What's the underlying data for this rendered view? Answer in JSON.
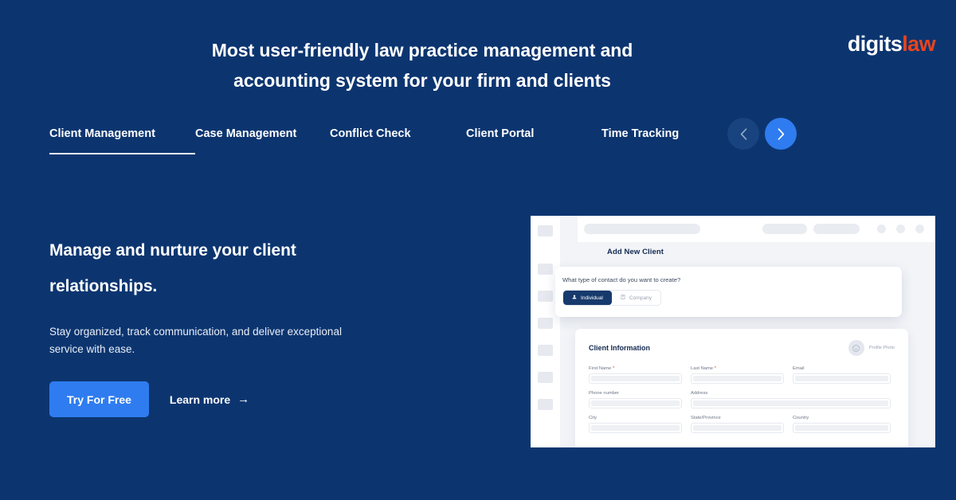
{
  "brand": {
    "logo_first": "digits",
    "logo_second": "law",
    "accent_orange": "#e8441f",
    "accent_blue": "#2f7cf0",
    "background_navy": "#0c3570"
  },
  "headline": {
    "line1": "Most user-friendly law practice management and",
    "line2": "accounting system for your firm and clients"
  },
  "tabs": [
    {
      "label": "Client Management",
      "active": true
    },
    {
      "label": "Case Management",
      "active": false
    },
    {
      "label": "Conflict Check",
      "active": false
    },
    {
      "label": "Client Portal",
      "active": false
    },
    {
      "label": "Time Tracking",
      "active": false
    }
  ],
  "carousel": {
    "prev_icon": "chevron-left-icon",
    "next_icon": "chevron-right-icon"
  },
  "hero": {
    "title_line1": "Manage and nurture your client",
    "title_line2": "relationships.",
    "sub_line1": "Stay organized, track communication, and deliver exceptional",
    "sub_line2": "service with ease.",
    "primary_cta": "Try For Free",
    "secondary_cta": "Learn more",
    "secondary_cta_arrow": "→"
  },
  "mockup": {
    "page_title": "Add New Client",
    "contact_card": {
      "question": "What type of contact do you want to create?",
      "options": [
        {
          "label": "Individual",
          "icon": "person-icon",
          "selected": true
        },
        {
          "label": "Company",
          "icon": "building-icon",
          "selected": false
        }
      ]
    },
    "client_card": {
      "heading": "Client Information",
      "avatar_label": "Profile Photo",
      "rows": [
        [
          {
            "label": "First Name",
            "required": true
          },
          {
            "label": "Last Name",
            "required": true
          },
          {
            "label": "Email",
            "required": false
          }
        ],
        [
          {
            "label": "Phone number",
            "required": false
          },
          {
            "label": "Address",
            "required": false
          }
        ],
        [
          {
            "label": "City",
            "required": false
          },
          {
            "label": "State/Province",
            "required": false
          },
          {
            "label": "Country",
            "required": false
          }
        ]
      ]
    }
  }
}
